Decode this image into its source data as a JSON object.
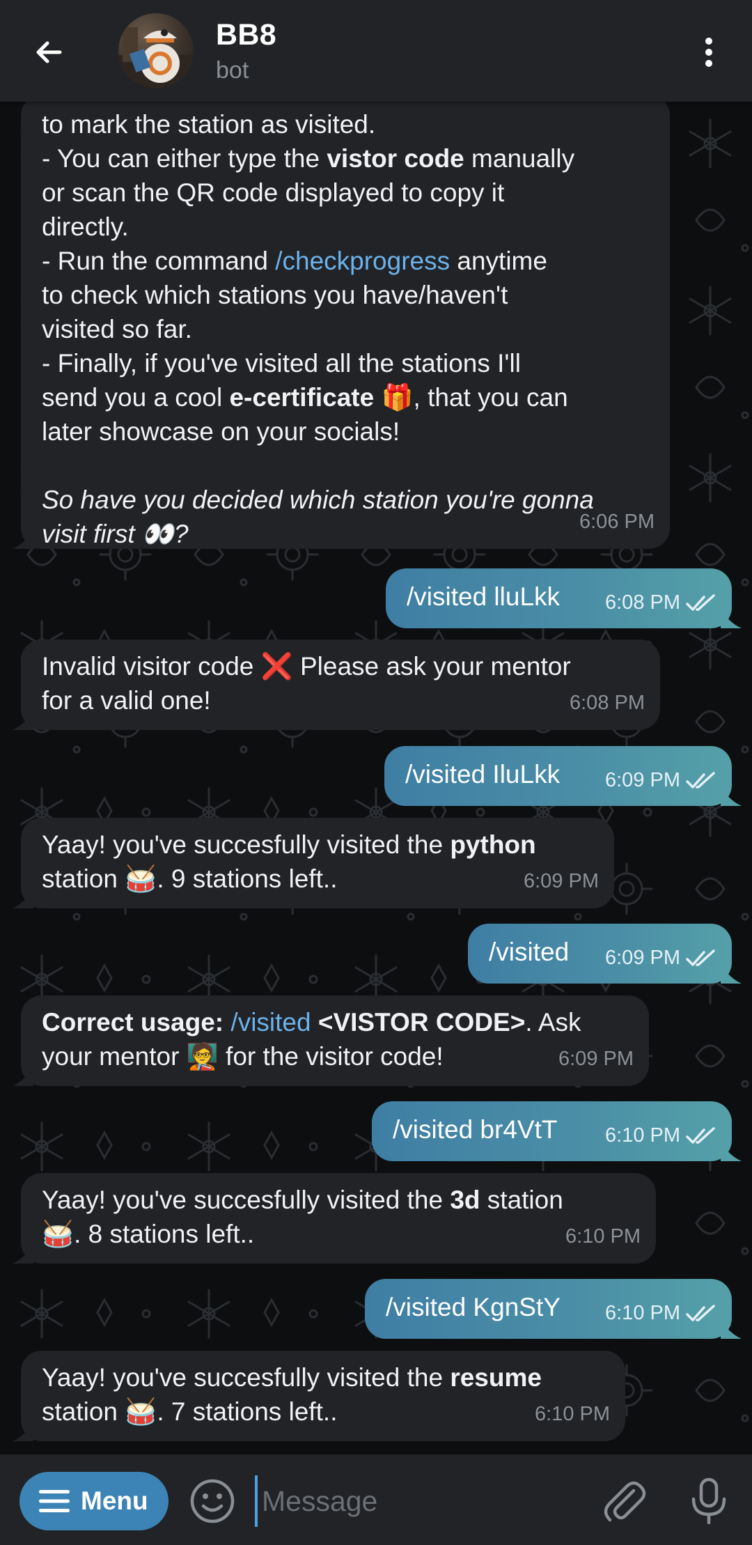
{
  "header": {
    "back_icon": "arrow-left-icon",
    "title": "BB8",
    "subtitle": "bot",
    "more_icon": "more-vertical-icon"
  },
  "messages": {
    "m1": {
      "l1": "to mark the station as visited.",
      "l2a": "- You can either type the ",
      "l2b": "vistor code",
      "l2c": " manually",
      "l3": "or scan the QR code displayed to copy it",
      "l4": "directly.",
      "l5a": "- Run the command ",
      "l5b": "/checkprogress",
      "l5c": " anytime",
      "l6": "to check which stations you have/haven't",
      "l7": "visited so far.",
      "l8": "- Finally, if you've visited all the stations I'll",
      "l9a": "send you a cool ",
      "l9b": "e-certificate",
      "l9c": " 🎁, that you can",
      "l10": "later showcase on your socials!",
      "l11": "So have you decided which station you're gonna",
      "l12": "visit first 👀?",
      "time": "6:06 PM"
    },
    "m2": {
      "text": "/visited lluLkk",
      "time": "6:08 PM"
    },
    "m3": {
      "l1": "Invalid visitor code ❌ Please ask your mentor",
      "l2": "for a valid one!",
      "time": "6:08 PM"
    },
    "m4": {
      "text": "/visited IluLkk",
      "time": "6:09 PM"
    },
    "m5": {
      "l1a": "Yaay! you've succesfully visited the ",
      "l1b": "python",
      "l2": "station 🥁. 9 stations left..",
      "time": "6:09 PM"
    },
    "m6": {
      "text": "/visited",
      "time": "6:09 PM"
    },
    "m7": {
      "l1a": "Correct usage: ",
      "l1b": "/visited",
      "l1c": " <VISTOR CODE>",
      "l1d": ". Ask",
      "l2": "your mentor 🧑‍🏫 for the visitor code!",
      "time": "6:09 PM"
    },
    "m8": {
      "text": "/visited br4VtT",
      "time": "6:10 PM"
    },
    "m9": {
      "l1a": "Yaay! you've succesfully visited the ",
      "l1b": "3d",
      "l1c": " station",
      "l2": "🥁. 8 stations left..",
      "time": "6:10 PM"
    },
    "m10": {
      "text": "/visited KgnStY",
      "time": "6:10 PM"
    },
    "m11": {
      "l1a": "Yaay! you've succesfully visited the ",
      "l1b": "resume",
      "l2": "station 🥁. 7 stations left..",
      "time": "6:10 PM"
    }
  },
  "input_bar": {
    "menu_label": "Menu",
    "placeholder": "Message",
    "icons": [
      "menu-lines-icon",
      "emoji-icon",
      "paperclip-icon",
      "microphone-icon"
    ]
  },
  "colors": {
    "header_bg": "#212326",
    "incoming_bubble": "#212326",
    "outgoing_bubble": "#4b8fa6",
    "link": "#6cb2eb",
    "menu_button": "#3d84b6"
  }
}
